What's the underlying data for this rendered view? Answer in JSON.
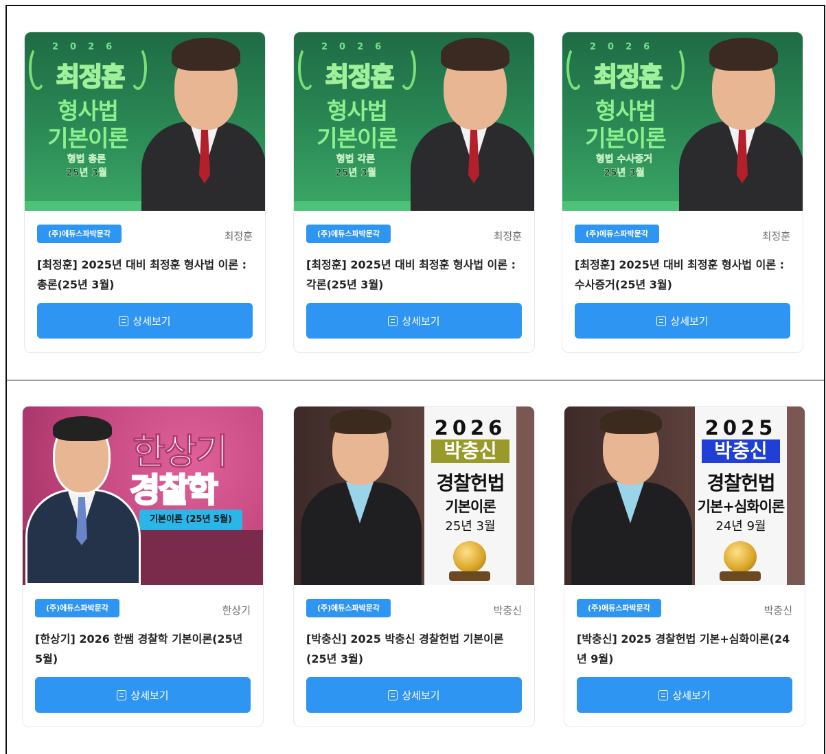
{
  "cards": [
    {
      "publisher": "(주)에듀스파박문각",
      "author": "최정훈",
      "title": "[최정훈] 2025년 대비 최정훈 형사법 이론 : 총론(25년 3월)",
      "button": "상세보기",
      "thumb": {
        "year": "2026",
        "name": "최정훈",
        "line1": "형사법",
        "line2": "기본이론",
        "small1": "형법 총론",
        "small2": "25년 3월"
      }
    },
    {
      "publisher": "(주)에듀스파박문각",
      "author": "최정훈",
      "title": "[최정훈] 2025년 대비 최정훈 형사법 이론 : 각론(25년 3월)",
      "button": "상세보기",
      "thumb": {
        "year": "2026",
        "name": "최정훈",
        "line1": "형사법",
        "line2": "기본이론",
        "small1": "형법 각론",
        "small2": "25년 3월"
      }
    },
    {
      "publisher": "(주)에듀스파박문각",
      "author": "최정훈",
      "title": "[최정훈] 2025년 대비 최정훈 형사법 이론 : 수사증거(25년 3월)",
      "button": "상세보기",
      "thumb": {
        "year": "2026",
        "name": "최정훈",
        "line1": "형사법",
        "line2": "기본이론",
        "small1": "형법 수사증거",
        "small2": "25년 3월"
      }
    },
    {
      "publisher": "(주)에듀스파박문각",
      "author": "한상기",
      "title": "[한상기] 2026 한쌤 경찰학 기본이론(25년 5월)",
      "button": "상세보기",
      "thumb": {
        "name": "한상기",
        "subject": "경찰학",
        "tag": "기본이론 (25년 5월)"
      }
    },
    {
      "publisher": "(주)에듀스파박문각",
      "author": "박충신",
      "title": "[박충신] 2025 박충신 경찰헌법 기본이론(25년 3월)",
      "button": "상세보기",
      "thumb": {
        "year": "2026",
        "name": "박충신",
        "subject": "경찰헌법",
        "course": "기본이론",
        "date": "25년 3월",
        "name_bg": "#9a9a2a"
      }
    },
    {
      "publisher": "(주)에듀스파박문각",
      "author": "박충신",
      "title": "[박충신] 2025 경찰헌법 기본+심화이론(24년 9월)",
      "button": "상세보기",
      "thumb": {
        "year": "2025",
        "name": "박충신",
        "subject": "경찰헌법",
        "course": "기본+심화이론",
        "date": "24년 9월",
        "name_bg": "#1f3fd6"
      }
    }
  ],
  "colors": {
    "accent": "#2f95f2"
  }
}
